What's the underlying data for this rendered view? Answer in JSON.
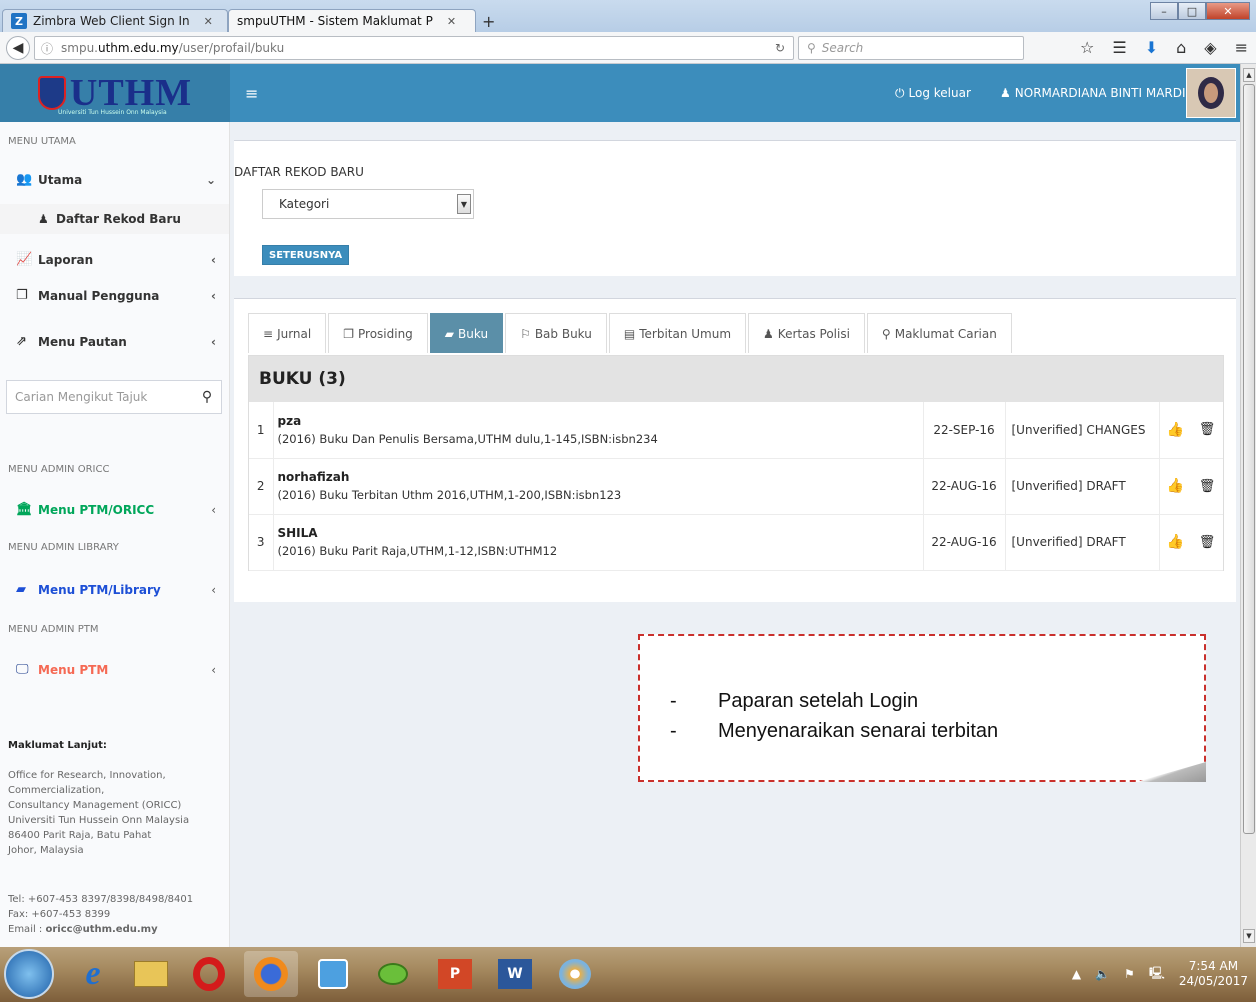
{
  "browser": {
    "tabs": [
      {
        "label": "Zimbra Web Client Sign In",
        "active": false
      },
      {
        "label": "smpuUTHM - Sistem Maklumat P",
        "active": true
      }
    ],
    "url_prefix": "smpu.",
    "url_domain": "uthm.edu.my",
    "url_path": "/user/profail/buku",
    "search_placeholder": "Search"
  },
  "header": {
    "logo_text": "UTHM",
    "logo_sub": "Universiti Tun Hussein Onn Malaysia",
    "logout_label": "Log keluar",
    "user_name": "NORMARDIANA BINTI MARDI"
  },
  "sidebar": {
    "menu_utama": "MENU UTAMA",
    "items": [
      {
        "label": "Utama"
      },
      {
        "label": "Daftar Rekod Baru"
      },
      {
        "label": "Laporan"
      },
      {
        "label": "Manual Pengguna"
      },
      {
        "label": "Menu Pautan"
      }
    ],
    "search_placeholder": "Carian Mengikut Tajuk",
    "admin_oricc": "MENU ADMIN ORICC",
    "menu_ptm_oricc": "Menu PTM/ORICC",
    "admin_library": "MENU ADMIN LIBRARY",
    "menu_ptm_library": "Menu PTM/Library",
    "admin_ptm": "MENU ADMIN PTM",
    "menu_ptm": "Menu PTM",
    "info_title": "Maklumat Lanjut:",
    "info_lines": [
      "Office for Research, Innovation,",
      "Commercialization,",
      "Consultancy Management (ORICC)",
      "Universiti Tun Hussein Onn Malaysia",
      "86400 Parit Raja, Batu Pahat",
      "Johor, Malaysia"
    ],
    "tel": "Tel: +607-453 8397/8398/8498/8401",
    "fax": "Fax: +607-453 8399",
    "email_label": "Email : ",
    "email": "oricc@uthm.edu.my"
  },
  "register": {
    "title": "DAFTAR REKOD BARU",
    "select_value": "Kategori",
    "button_label": "SETERUSNYA"
  },
  "tabs": [
    {
      "label": "Jurnal",
      "icon": "≡"
    },
    {
      "label": "Prosiding",
      "icon": "❐"
    },
    {
      "label": "Buku",
      "icon": "▰"
    },
    {
      "label": "Bab Buku",
      "icon": "⚐"
    },
    {
      "label": "Terbitan Umum",
      "icon": "▤"
    },
    {
      "label": "Kertas Polisi",
      "icon": "♟"
    },
    {
      "label": "Maklumat Carian",
      "icon": "⚲"
    }
  ],
  "books": {
    "heading": "BUKU (3)",
    "rows": [
      {
        "no": "1",
        "title": "pza",
        "detail": "(2016) Buku Dan Penulis Bersama,UTHM dulu,1-145,ISBN:isbn234",
        "date": "22-SEP-16",
        "status": "[Unverified] CHANGES"
      },
      {
        "no": "2",
        "title": "norhafizah",
        "detail": "(2016) Buku Terbitan Uthm 2016,UTHM,1-200,ISBN:isbn123",
        "date": "22-AUG-16",
        "status": "[Unverified] DRAFT"
      },
      {
        "no": "3",
        "title": "SHILA",
        "detail": "(2016) Buku Parit Raja,UTHM,1-12,ISBN:UTHM12",
        "date": "22-AUG-16",
        "status": "[Unverified] DRAFT"
      }
    ]
  },
  "callout": {
    "line1": "Paparan setelah Login",
    "line2": "Menyenaraikan senarai terbitan",
    "bullet": "-"
  },
  "taskbar": {
    "time": "7:54 AM",
    "date": "24/05/2017"
  }
}
